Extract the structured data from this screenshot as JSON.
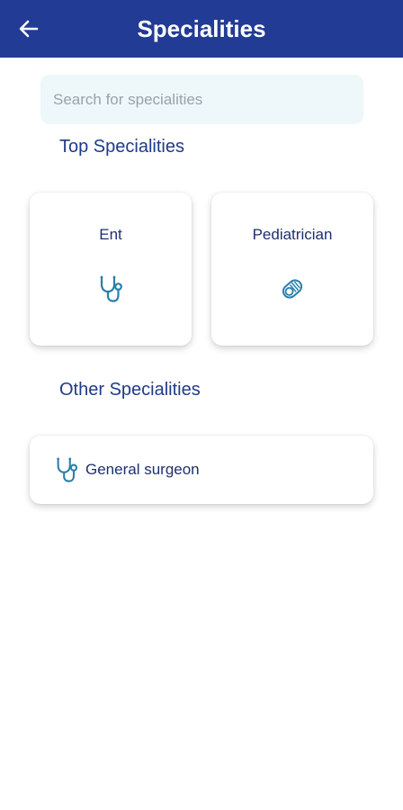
{
  "header": {
    "title": "Specialities",
    "back_icon": "arrow-left-icon",
    "background": "#223b94"
  },
  "search": {
    "placeholder": "Search for specialities",
    "value": ""
  },
  "top_section": {
    "title": "Top Specialities",
    "items": [
      {
        "label": "Ent",
        "icon": "stethoscope-icon"
      },
      {
        "label": "Pediatrician",
        "icon": "baby-icon"
      }
    ]
  },
  "other_section": {
    "title": "Other Specialities",
    "items": [
      {
        "label": "General surgeon",
        "icon": "stethoscope-icon"
      }
    ]
  },
  "colors": {
    "accent": "#1f3a8a",
    "icon": "#2a7fa8",
    "search_bg": "#eef7f9"
  }
}
